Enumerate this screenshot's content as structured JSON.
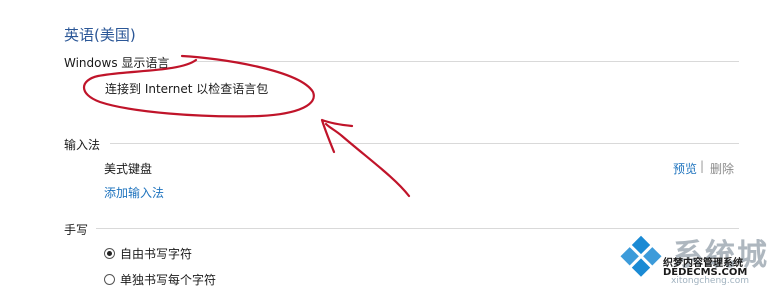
{
  "header": {
    "title": "英语(美国)"
  },
  "display_language": {
    "label": "Windows 显示语言",
    "message": "连接到 Internet 以检查语言包"
  },
  "input_method": {
    "label": "输入法",
    "keyboard_name": "美式键盘",
    "preview_link": "预览",
    "separator": "|",
    "delete_link": "删除",
    "add_link": "添加输入法"
  },
  "handwriting": {
    "label": "手写",
    "options": [
      {
        "label": "自由书写字符",
        "selected": true
      },
      {
        "label": "单独书写每个字符",
        "selected": false
      }
    ]
  },
  "watermark": {
    "brand_big": "系统城",
    "line1": "织梦内容管理系统",
    "line2": "DEDECMS.COM",
    "sub": "xitongcheng.com"
  },
  "colors": {
    "title": "#2b5797",
    "link": "#1e73be",
    "annotation": "#c0142a"
  }
}
